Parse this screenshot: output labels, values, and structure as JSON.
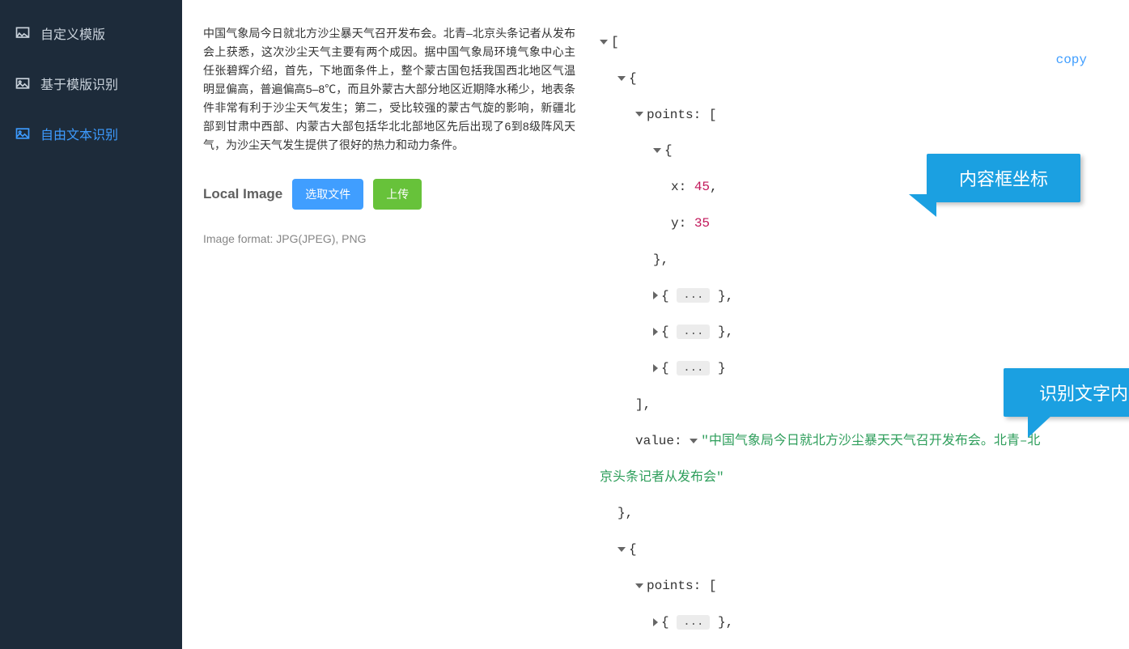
{
  "sidebar": {
    "items": [
      {
        "label": "自定义模版"
      },
      {
        "label": "基于模版识别"
      },
      {
        "label": "自由文本识别"
      }
    ]
  },
  "paragraph": "中国气象局今日就北方沙尘暴天气召开发布会。北青–北京头条记者从发布会上获悉，这次沙尘天气主要有两个成因。据中国气象局环境气象中心主任张碧辉介绍，首先，下地面条件上，整个蒙古国包括我国西北地区气温明显偏高，普遍偏高5–8℃，而且外蒙古大部分地区近期降水稀少，地表条件非常有利于沙尘天气发生；第二，受比较强的蒙古气旋的影响，新疆北部到甘肃中西部、内蒙古大部包括华北北部地区先后出现了6到8级阵风天气，为沙尘天气发生提供了很好的热力和动力条件。",
  "upload": {
    "local_label": "Local Image",
    "select_btn": "选取文件",
    "upload_btn": "上传",
    "hint": "Image format: JPG(JPEG), PNG"
  },
  "copy_label": "copy",
  "json_tree": {
    "points_key": "points",
    "x_key": "x:",
    "y_key": "y:",
    "x_val": "45",
    "y_val": "35",
    "value_key": "value:",
    "value_str": "\"中国气象局今日就北方沙尘暴天天气召开发布会。北青–北京头条记者从发布会\"",
    "ellipsis": "..."
  },
  "callouts": {
    "coord": "内容框坐标",
    "text": "识别文字内容"
  }
}
